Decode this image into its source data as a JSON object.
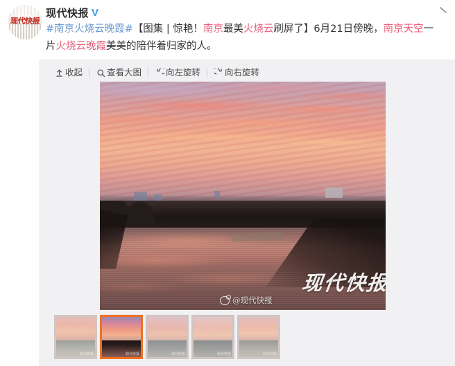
{
  "post": {
    "nickname": "现代快报",
    "verified_badge": "V",
    "avatar_text": "现代快报",
    "text_segments": [
      {
        "t": "#南京火烧云晚霞#",
        "style": "hashtag"
      },
      {
        "t": "【图集 | 惊艳！",
        "style": "plain"
      },
      {
        "t": "南京",
        "style": "hl"
      },
      {
        "t": "最美",
        "style": "plain"
      },
      {
        "t": "火烧云",
        "style": "hl"
      },
      {
        "t": "刷屏了】",
        "style": "plain"
      },
      {
        "t": "6月21日傍晚，",
        "style": "plain"
      },
      {
        "t": "南京天空",
        "style": "hl"
      },
      {
        "t": "一片",
        "style": "plain"
      },
      {
        "t": "火烧云晚霞",
        "style": "hl"
      },
      {
        "t": "美美的陪伴着归家的人。",
        "style": "plain"
      }
    ],
    "collapse_arrow_icon": "chevron-down-icon"
  },
  "toolbar": {
    "items": [
      {
        "label": "收起",
        "icon": "collapse-up-icon",
        "name": "collapse-button"
      },
      {
        "label": "查看大图",
        "icon": "search-icon",
        "name": "view-large-button"
      },
      {
        "label": "向左旋转",
        "icon": "rotate-left-icon",
        "name": "rotate-left-button"
      },
      {
        "label": "向右旋转",
        "icon": "rotate-right-icon",
        "name": "rotate-right-button"
      }
    ]
  },
  "main_image": {
    "alt": "南京火烧云晚霞 沿河夕阳",
    "watermark_large": "现代快报",
    "watermark_small": "@现代快报",
    "weibo_icon": "weibo-logo-icon"
  },
  "thumbnails": [
    {
      "index": 1,
      "selected": false,
      "watermark": "现代快报",
      "sky_css": "linear-gradient(180deg,#e3bcb9 0%,#edb8a8 35%,#f0c3ac 65%,#dcb0a6 100%)",
      "ground_css": "linear-gradient(180deg,#9aa09c 0%,#b3b2ac 40%,#c9c3bc 100%)"
    },
    {
      "index": 2,
      "selected": true,
      "watermark": "现代快报",
      "sky_css": "linear-gradient(180deg,#9d88ad 0%,#d4869a 28%,#ef9b84 55%,#f3b191 78%,#caa093 100%)",
      "ground_css": "linear-gradient(180deg,#1d1514 0%,#2b1f1d 30%,#63433e 70%,#8c5c52 100%)"
    },
    {
      "index": 3,
      "selected": false,
      "watermark": "现代快报",
      "sky_css": "linear-gradient(180deg,#dfc2c6 0%,#e8b6ad 45%,#edc3ae 75%,#d9b6ae 100%)",
      "ground_css": "linear-gradient(180deg,#8e9193 0%,#a2a3a1 50%,#b6b5b1 100%)"
    },
    {
      "index": 4,
      "selected": false,
      "watermark": "现代快报",
      "sky_css": "linear-gradient(180deg,#e2c6c8 0%,#ecbcb0 45%,#efc6b0 75%,#dcb9b0 100%)",
      "ground_css": "linear-gradient(180deg,#8b8e90 0%,#9fa09e 50%,#b3b2ae 100%)"
    },
    {
      "index": 5,
      "selected": false,
      "watermark": "现代快报",
      "sky_css": "linear-gradient(180deg,#e0c0c0 0%,#eeb9a9 42%,#f0c6b0 72%,#d8b3ab 100%)",
      "ground_css": "linear-gradient(180deg,#9a9b98 0%,#b0aea8 45%,#c5bfb8 100%)"
    }
  ],
  "colors": {
    "panel_bg": "#f1f1f3",
    "page_bg": "#ffffff",
    "accent_orange": "#f07022",
    "hashtag_blue": "#6a9bd1",
    "highlight_pink": "#e8607c",
    "verified_blue": "#3b9ae1",
    "text_dark": "#333333",
    "toolbar_text": "#4c4c4c",
    "avatar_red": "#c7362b"
  }
}
